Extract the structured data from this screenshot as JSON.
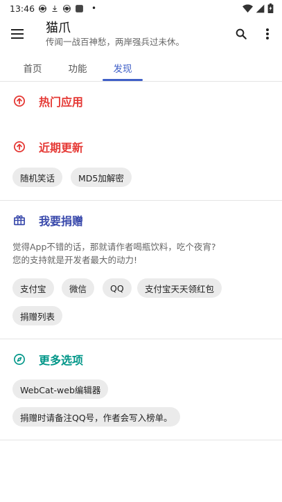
{
  "status_bar": {
    "time": "13:46",
    "dot": "•",
    "icons_left": [
      "sync-icon",
      "download-icon",
      "sync-icon",
      "app-square-icon"
    ],
    "icons_right": [
      "wifi-icon",
      "signal-icon",
      "battery-icon"
    ]
  },
  "app_bar": {
    "title": "猫爪",
    "subtitle": "传闻一战百神愁，两岸强兵过未休。"
  },
  "tabs": [
    {
      "label": "首页"
    },
    {
      "label": "功能"
    },
    {
      "label": "发现"
    }
  ],
  "active_tab": 2,
  "colors": {
    "accent": "#3f5fc7",
    "hot_red": "#e53935",
    "donate_blue": "#3949ab",
    "more_teal": "#009688",
    "chip_bg": "#ebebeb"
  },
  "sections": {
    "hot_apps": {
      "title": "热门应用",
      "icon": "arrow-up-circle-icon"
    },
    "recent": {
      "title": "近期更新",
      "icon": "arrow-up-circle-icon",
      "chips": [
        "随机笑话",
        "MD5加解密"
      ]
    },
    "donate": {
      "title": "我要捐赠",
      "icon": "gift-icon",
      "desc_line1": "觉得App不错的话，那就请作者喝瓶饮料，吃个夜宵?",
      "desc_line2": "您的支持就是开发者最大的动力!",
      "chips": [
        "支付宝",
        "微信",
        "QQ",
        "支付宝天天领红包",
        "捐赠列表"
      ]
    },
    "more": {
      "title": "更多选项",
      "icon": "compass-icon",
      "chips": [
        "WebCat-web编辑器",
        "捐赠时请备注QQ号，作者会写入榜单。"
      ]
    }
  }
}
